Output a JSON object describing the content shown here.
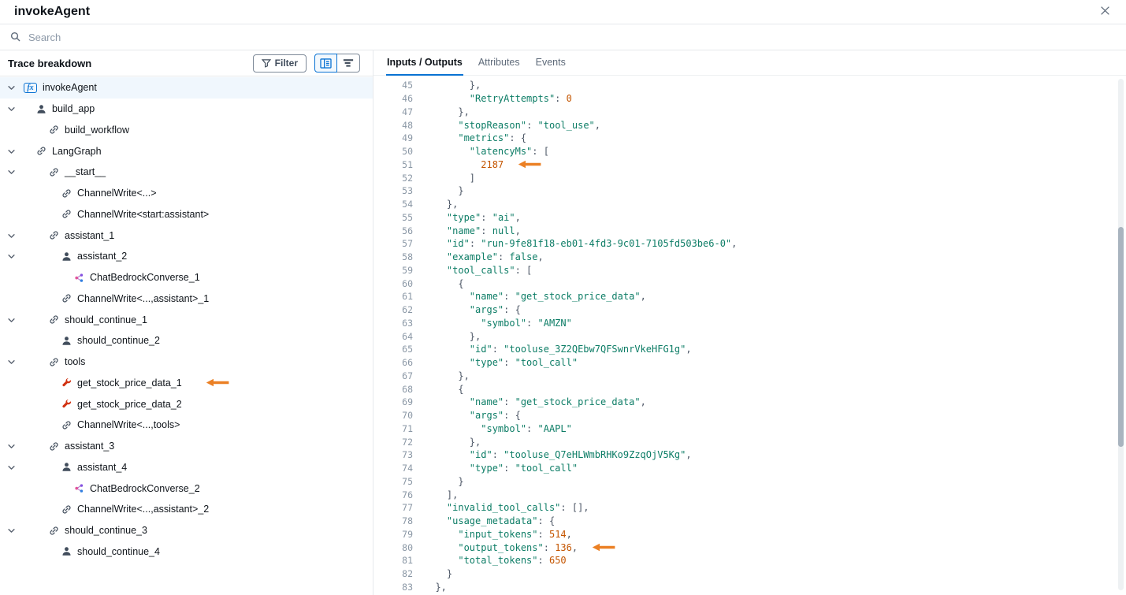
{
  "colors": {
    "accent": "#0972d3",
    "string_token": "#0d7d66",
    "number_token": "#c45500",
    "annotation_arrow": "#eb8024",
    "tool_icon": "#d13212"
  },
  "icons": {
    "fx_glyph": "fx"
  },
  "window": {
    "title": "invokeAgent"
  },
  "search": {
    "placeholder": "Search"
  },
  "trace_panel": {
    "title": "Trace breakdown",
    "filter_label": "Filter",
    "tree": [
      {
        "label": "invokeAgent",
        "icon": "fx-icon",
        "level": 0,
        "expandable": true,
        "selected": true
      },
      {
        "label": "build_app",
        "icon": "agent-icon",
        "level": 1,
        "expandable": true
      },
      {
        "label": "build_workflow",
        "icon": "chain-icon",
        "level": 2
      },
      {
        "label": "LangGraph",
        "icon": "chain-icon",
        "level": 1,
        "expandable": true
      },
      {
        "label": "__start__",
        "icon": "chain-icon",
        "level": 2,
        "expandable": true
      },
      {
        "label": "ChannelWrite<...>",
        "icon": "chain-icon",
        "level": 3
      },
      {
        "label": "ChannelWrite<start:assistant>",
        "icon": "chain-icon",
        "level": 3
      },
      {
        "label": "assistant_1",
        "icon": "chain-icon",
        "level": 2,
        "expandable": true
      },
      {
        "label": "assistant_2",
        "icon": "agent-icon",
        "level": 3,
        "expandable": true
      },
      {
        "label": "ChatBedrockConverse_1",
        "icon": "model-icon",
        "level": 4
      },
      {
        "label": "ChannelWrite<...,assistant>_1",
        "icon": "chain-icon",
        "level": 3
      },
      {
        "label": "should_continue_1",
        "icon": "chain-icon",
        "level": 2,
        "expandable": true
      },
      {
        "label": "should_continue_2",
        "icon": "agent-icon",
        "level": 3
      },
      {
        "label": "tools",
        "icon": "chain-icon",
        "level": 2,
        "expandable": true
      },
      {
        "label": "get_stock_price_data_1",
        "icon": "tool-icon",
        "level": 3,
        "annotated": true
      },
      {
        "label": "get_stock_price_data_2",
        "icon": "tool-icon",
        "level": 3
      },
      {
        "label": "ChannelWrite<...,tools>",
        "icon": "chain-icon",
        "level": 3
      },
      {
        "label": "assistant_3",
        "icon": "chain-icon",
        "level": 2,
        "expandable": true
      },
      {
        "label": "assistant_4",
        "icon": "agent-icon",
        "level": 3,
        "expandable": true
      },
      {
        "label": "ChatBedrockConverse_2",
        "icon": "model-icon",
        "level": 4
      },
      {
        "label": "ChannelWrite<...,assistant>_2",
        "icon": "chain-icon",
        "level": 3
      },
      {
        "label": "should_continue_3",
        "icon": "chain-icon",
        "level": 2,
        "expandable": true
      },
      {
        "label": "should_continue_4",
        "icon": "agent-icon",
        "level": 3
      }
    ]
  },
  "detail_panel": {
    "tabs": [
      {
        "label": "Inputs / Outputs",
        "active": true
      },
      {
        "label": "Attributes",
        "active": false
      },
      {
        "label": "Events",
        "active": false
      }
    ],
    "code_lines": [
      {
        "n": 45,
        "text": "        },"
      },
      {
        "n": 46,
        "text": "        \"RetryAttempts\": 0"
      },
      {
        "n": 47,
        "text": "      },"
      },
      {
        "n": 48,
        "text": "      \"stopReason\": \"tool_use\","
      },
      {
        "n": 49,
        "text": "      \"metrics\": {"
      },
      {
        "n": 50,
        "text": "        \"latencyMs\": ["
      },
      {
        "n": 51,
        "text": "          2187",
        "annotated": true
      },
      {
        "n": 52,
        "text": "        ]"
      },
      {
        "n": 53,
        "text": "      }"
      },
      {
        "n": 54,
        "text": "    },"
      },
      {
        "n": 55,
        "text": "    \"type\": \"ai\","
      },
      {
        "n": 56,
        "text": "    \"name\": null,"
      },
      {
        "n": 57,
        "text": "    \"id\": \"run-9fe81f18-eb01-4fd3-9c01-7105fd503be6-0\","
      },
      {
        "n": 58,
        "text": "    \"example\": false,"
      },
      {
        "n": 59,
        "text": "    \"tool_calls\": ["
      },
      {
        "n": 60,
        "text": "      {"
      },
      {
        "n": 61,
        "text": "        \"name\": \"get_stock_price_data\","
      },
      {
        "n": 62,
        "text": "        \"args\": {"
      },
      {
        "n": 63,
        "text": "          \"symbol\": \"AMZN\""
      },
      {
        "n": 64,
        "text": "        },"
      },
      {
        "n": 65,
        "text": "        \"id\": \"tooluse_3Z2QEbw7QFSwnrVkeHFG1g\","
      },
      {
        "n": 66,
        "text": "        \"type\": \"tool_call\""
      },
      {
        "n": 67,
        "text": "      },"
      },
      {
        "n": 68,
        "text": "      {"
      },
      {
        "n": 69,
        "text": "        \"name\": \"get_stock_price_data\","
      },
      {
        "n": 70,
        "text": "        \"args\": {"
      },
      {
        "n": 71,
        "text": "          \"symbol\": \"AAPL\""
      },
      {
        "n": 72,
        "text": "        },"
      },
      {
        "n": 73,
        "text": "        \"id\": \"tooluse_Q7eHLWmbRHKo9ZzqOjV5Kg\","
      },
      {
        "n": 74,
        "text": "        \"type\": \"tool_call\""
      },
      {
        "n": 75,
        "text": "      }"
      },
      {
        "n": 76,
        "text": "    ],"
      },
      {
        "n": 77,
        "text": "    \"invalid_tool_calls\": [],"
      },
      {
        "n": 78,
        "text": "    \"usage_metadata\": {"
      },
      {
        "n": 79,
        "text": "      \"input_tokens\": 514,"
      },
      {
        "n": 80,
        "text": "      \"output_tokens\": 136,",
        "annotated": true
      },
      {
        "n": 81,
        "text": "      \"total_tokens\": 650"
      },
      {
        "n": 82,
        "text": "    }"
      },
      {
        "n": 83,
        "text": "  },"
      }
    ]
  }
}
